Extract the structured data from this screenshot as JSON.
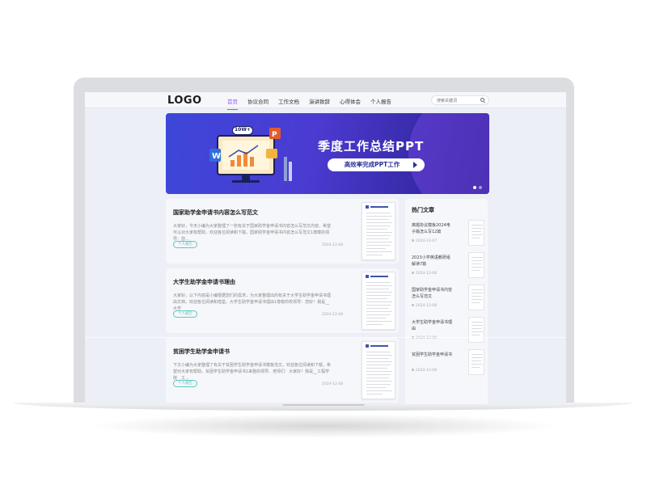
{
  "header": {
    "logo": "LOGO",
    "menu": [
      "首页",
      "协议合同",
      "工作文档",
      "演讲致辞",
      "心得体会",
      "个人报告"
    ],
    "search_placeholder": "搜索关键词"
  },
  "banner": {
    "badge": "10W+",
    "title": "季度工作总结PPT",
    "button": "高效率完成PPT工作",
    "slides": 2,
    "active_slide": 1
  },
  "articles": [
    {
      "title": "国家助学金申请书内容怎么写范文",
      "excerpt": "大家好，今天小编为大家整理了一些有关于国家助学金申请书内容怎么写范文内容，希望可以对大家有帮助，欢迎各位阅读和下载。国家助学金申请书内容怎么写范文1尊敬的领导：您…",
      "tag": "个人报告",
      "date": "2024-12-08"
    },
    {
      "title": "大学生助学金申请书理由",
      "excerpt": "大家好，以下内容是小编根据您们的需求，为大家整理出的有关于大学生助学金申请书理由文档，欢迎各位阅读和借鉴。大学生助学金申请书理由1尊敬的校领导：您好！我是__大学__",
      "tag": "个人报告",
      "date": "2024-12-08"
    },
    {
      "title": "贫困学生助学金申请书",
      "excerpt": "下文小编为大家整理了有关于贫困学生助学金申请书模板范文，欢迎各位阅读和下载，希望对大家有帮助。贫困学生助学金申请书1来整的领导、老师们：大家好！我是__工程学院__工…",
      "tag": "个人报告",
      "date": "2024-12-08"
    }
  ],
  "sidebar": {
    "title": "热门文章",
    "items": [
      {
        "title": "离婚协议模板2024电子版怎么写12篇",
        "date": "2024-12-07"
      },
      {
        "title": "2023小学英语教研组解读7篇",
        "date": "2024-12-08"
      },
      {
        "title": "国家助学金申请书内容怎么写范文",
        "date": "2024-12-08"
      },
      {
        "title": "大学生助学金申请书理由",
        "date": "2024-12-08"
      },
      {
        "title": "贫困学生助学金申请书",
        "date": "2024-12-08"
      }
    ]
  },
  "colors": {
    "accent": "#8b5cf6",
    "tag": "#5fc7c3",
    "banner_start": "#3d47d9",
    "banner_end": "#2a1f8c"
  }
}
